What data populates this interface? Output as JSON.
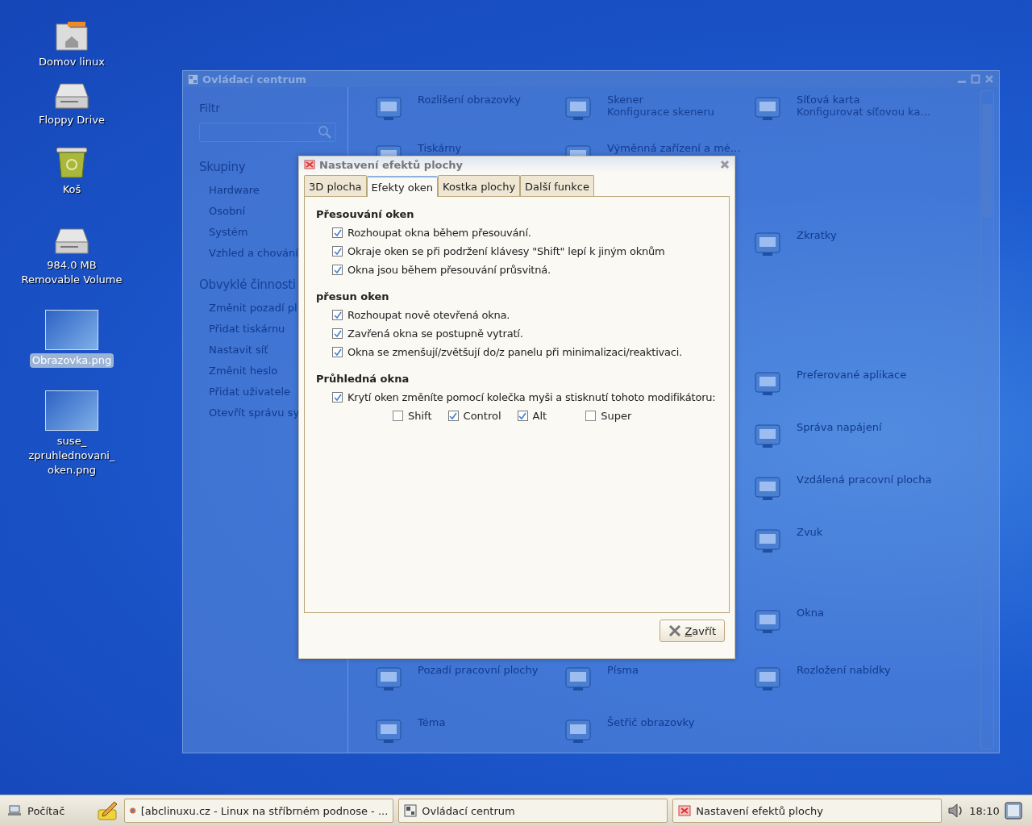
{
  "desktop": {
    "icons": [
      {
        "label": "Domov linux",
        "kind": "folder",
        "selected": false
      },
      {
        "label": "Floppy Drive",
        "kind": "drive",
        "selected": false
      },
      {
        "label": "Koš",
        "kind": "trash",
        "selected": false
      },
      {
        "label": "984.0 MB Removable Volume",
        "kind": "drive",
        "selected": false
      },
      {
        "label": "Obrazovka.png",
        "kind": "image",
        "selected": true
      },
      {
        "label": "suse_zpruhlednovani_oken.png",
        "kind": "image",
        "selected": false
      }
    ]
  },
  "control_center": {
    "title": "Ovládací centrum",
    "sidebar": {
      "filter_label": "Filtr",
      "groups_heading": "Skupiny",
      "groups": [
        "Hardware",
        "Osobní",
        "Systém",
        "Vzhled a chování"
      ],
      "tasks_heading": "Obvyklé činnosti",
      "tasks": [
        "Změnit pozadí pl",
        "Přidat tiskárnu",
        "Nastavit síť",
        "Změnit heslo",
        "Přidat uživatele",
        "Otevřít správu sy"
      ]
    },
    "rows": [
      {
        "left": {
          "title": "Rozlišení obrazovky"
        },
        "middle": {
          "title": "Skener",
          "subtitle": "Konfigurace skeneru"
        },
        "right": {
          "title": "Síťová karta",
          "subtitle": "Konfigurovat síťovou ka…"
        }
      },
      {
        "left": {
          "title": "Tiskárny"
        },
        "middle": {
          "title": "Výměnná zařízení a mé…"
        }
      },
      {
        "right": {
          "title": "Zkratky"
        }
      },
      {
        "right": {
          "title": "Preferované aplikace"
        }
      },
      {
        "right": {
          "title": "Správa napájení"
        }
      },
      {
        "right": {
          "title": "Vzdálená pracovní plocha"
        }
      },
      {
        "right": {
          "title": "Zvuk"
        }
      },
      {
        "right": {
          "title": "Okna"
        }
      },
      {
        "left": {
          "title": "Pozadí pracovní plochy"
        },
        "middle": {
          "title": "Písma"
        },
        "right": {
          "title": "Rozložení nabídky"
        }
      },
      {
        "left": {
          "title": "Téma"
        },
        "middle": {
          "title": "Šetřič obrazovky"
        }
      }
    ]
  },
  "dialog": {
    "title": "Nastavení efektů plochy",
    "tabs": [
      {
        "label": "3D plocha",
        "selected": false
      },
      {
        "label": "Efekty oken",
        "selected": true
      },
      {
        "label": "Kostka plochy",
        "selected": false
      },
      {
        "label": "Další funkce",
        "selected": false
      }
    ],
    "sections": [
      {
        "heading": "Přesouvání oken",
        "options": [
          {
            "label": "Rozhoupat okna během přesouvání.",
            "checked": true
          },
          {
            "label": "Okraje oken se při podržení klávesy \"Shift\" lepí k jiným oknům",
            "checked": true
          },
          {
            "label": "Okna jsou během přesouvání průsvitná.",
            "checked": true
          }
        ]
      },
      {
        "heading": "přesun oken",
        "options": [
          {
            "label": "Rozhoupat nově otevřená okna.",
            "checked": true
          },
          {
            "label": "Zavřená okna se postupně vytratí.",
            "checked": true
          },
          {
            "label": "Okna se zmenšují/zvětšují do/z panelu při minimalizaci/reaktivaci.",
            "checked": true
          }
        ]
      },
      {
        "heading": "Průhledná okna",
        "options": [
          {
            "label": "Krytí oken změníte pomocí kolečka myši a stisknutí tohoto modifikátoru:",
            "checked": true
          }
        ],
        "modifiers": [
          {
            "label": "Shift",
            "checked": false
          },
          {
            "label": "Control",
            "checked": true
          },
          {
            "label": "Alt",
            "checked": true
          },
          {
            "label": "Super",
            "checked": false
          }
        ]
      }
    ],
    "close_button": "Zavřít"
  },
  "taskbar": {
    "start": "Počítač",
    "tasks": [
      {
        "label": "[abclinuxu.cz - Linux na stříbrném podnose - ...",
        "kind": "browser"
      },
      {
        "label": "Ovládací centrum",
        "kind": "panel"
      },
      {
        "label": "Nastavení efektů plochy",
        "kind": "effects"
      }
    ],
    "clock": "18:10"
  }
}
